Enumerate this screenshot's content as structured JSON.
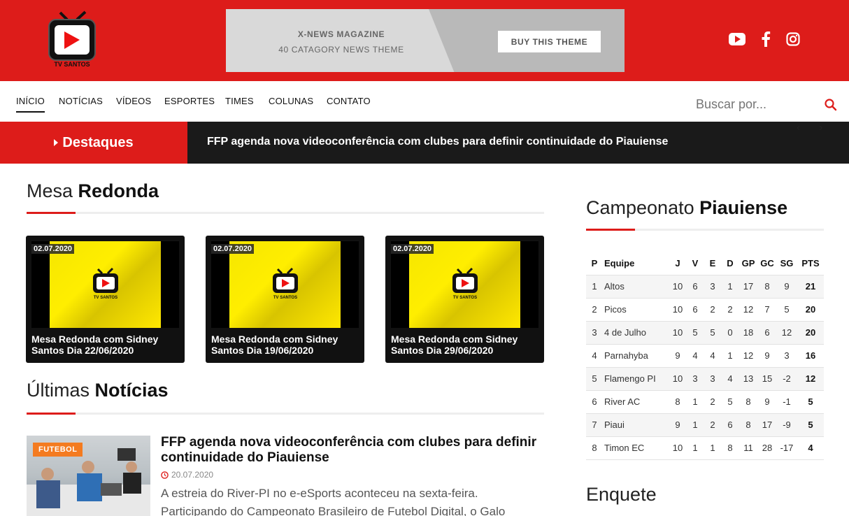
{
  "header": {
    "logo_text": "TV SANTOS",
    "banner": {
      "line1": "X-NEWS MAGAZINE",
      "line2": "40 CATAGORY NEWS THEME",
      "button": "BUY THIS THEME"
    },
    "social": [
      "youtube-icon",
      "facebook-icon",
      "instagram-icon"
    ],
    "brand_color": "#dd1c1a"
  },
  "nav": {
    "items": [
      "INÍCIO",
      "NOTÍCIAS",
      "VÍDEOS",
      "ESPORTES",
      "TIMES",
      "COLUNAS",
      "CONTATO"
    ],
    "search_placeholder": "Buscar por..."
  },
  "ticker": {
    "label": "Destaques",
    "headline": "FFP agenda nova videoconferência com clubes para definir continuidade do Piauiense",
    "prev": "‹",
    "next": "›"
  },
  "mesa": {
    "title_light": "Mesa",
    "title_bold": "Redonda",
    "cards": [
      {
        "date": "02.07.2020",
        "title": "Mesa Redonda com Sidney Santos Dia 22/06/2020"
      },
      {
        "date": "02.07.2020",
        "title": "Mesa Redonda com Sidney Santos Dia 19/06/2020"
      },
      {
        "date": "02.07.2020",
        "title": "Mesa Redonda com Sidney Santos Dia 29/06/2020"
      }
    ]
  },
  "ultimas": {
    "title_light": "Últimas",
    "title_bold": "Notícias",
    "article": {
      "category": "FUTEBOL",
      "title": "FFP agenda nova videoconferência com clubes para definir continuidade do Piauiense",
      "date": "20.07.2020",
      "excerpt": "A estreia do River-PI no e-eSports aconteceu na sexta-feira. Participando do Campeonato Brasileiro de Futebol Digital, o Galo"
    }
  },
  "campeonato": {
    "title_light": "Campeonato",
    "title_bold": "Piauiense",
    "headers": [
      "P",
      "Equipe",
      "J",
      "V",
      "E",
      "D",
      "GP",
      "GC",
      "SG",
      "PTS"
    ],
    "rows": [
      [
        "1",
        "Altos",
        "10",
        "6",
        "3",
        "1",
        "17",
        "8",
        "9",
        "21"
      ],
      [
        "2",
        "Picos",
        "10",
        "6",
        "2",
        "2",
        "12",
        "7",
        "5",
        "20"
      ],
      [
        "3",
        "4 de Julho",
        "10",
        "5",
        "5",
        "0",
        "18",
        "6",
        "12",
        "20"
      ],
      [
        "4",
        "Parnahyba",
        "9",
        "4",
        "4",
        "1",
        "12",
        "9",
        "3",
        "16"
      ],
      [
        "5",
        "Flamengo PI",
        "10",
        "3",
        "3",
        "4",
        "13",
        "15",
        "-2",
        "12"
      ],
      [
        "6",
        "River AC",
        "8",
        "1",
        "2",
        "5",
        "8",
        "9",
        "-1",
        "5"
      ],
      [
        "7",
        "Piaui",
        "9",
        "1",
        "2",
        "6",
        "8",
        "17",
        "-9",
        "5"
      ],
      [
        "8",
        "Timon EC",
        "10",
        "1",
        "1",
        "8",
        "11",
        "28",
        "-17",
        "4"
      ]
    ]
  },
  "enquete": {
    "title": "Enquete"
  }
}
